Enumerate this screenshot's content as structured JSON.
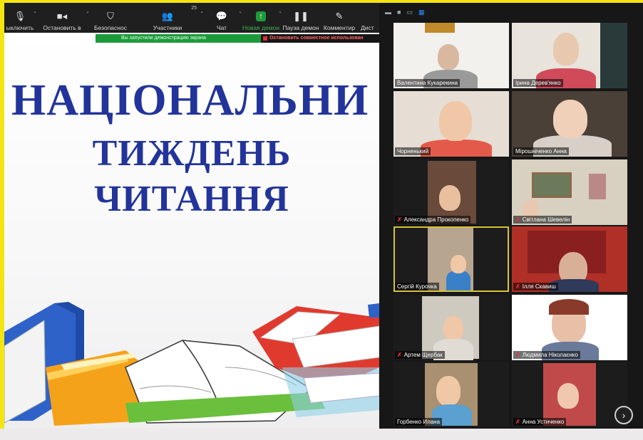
{
  "toolbar": {
    "items": [
      {
        "label": "ыключить",
        "icon": "microphone-icon"
      },
      {
        "label": "Остановить в",
        "icon": "video-camera-icon"
      },
      {
        "label": "Безопаснос",
        "icon": "shield-icon"
      },
      {
        "label": "Участники",
        "icon": "participants-icon",
        "count": "25"
      },
      {
        "label": "Чат",
        "icon": "chat-icon"
      },
      {
        "label": "Новая демон",
        "icon": "share-screen-icon"
      },
      {
        "label": "Пауза демон",
        "icon": "pause-icon"
      },
      {
        "label": "Комментир",
        "icon": "annotate-pencil-icon"
      },
      {
        "label": "Дист",
        "icon": "remote-control-icon"
      }
    ]
  },
  "banner": {
    "sharing": "Вы запустили демонстрацию экрана",
    "stop": "Остановить совместное использован"
  },
  "slide": {
    "line1": "НАЦІОНАЛЬНИ",
    "line2": "ТИЖДЕНЬ",
    "line3": "ЧИТАННЯ"
  },
  "participants": [
    {
      "name": "Валентина Кукарекина",
      "muted": false
    },
    {
      "name": "Ірина Дерев'янко",
      "muted": false
    },
    {
      "name": "Чорненький",
      "muted": false
    },
    {
      "name": "Мірошніченко Анна",
      "muted": false
    },
    {
      "name": "Александра Прокопенко",
      "muted": true
    },
    {
      "name": "Світлана Шевелін",
      "muted": true
    },
    {
      "name": "Сергій Курочка",
      "muted": false
    },
    {
      "name": "Ілля Скавиш",
      "muted": true
    },
    {
      "name": "Артем Щербак",
      "muted": true
    },
    {
      "name": "Людмила Ніколаєнко",
      "muted": true
    },
    {
      "name": "Горбенко Илана",
      "muted": false
    },
    {
      "name": "Анна Устиченко",
      "muted": true
    }
  ],
  "colors": {
    "accent_green": "#1f9a3a",
    "title_blue": "#22349a",
    "mute_red": "#e23030",
    "frame_yellow": "#f3e512"
  }
}
